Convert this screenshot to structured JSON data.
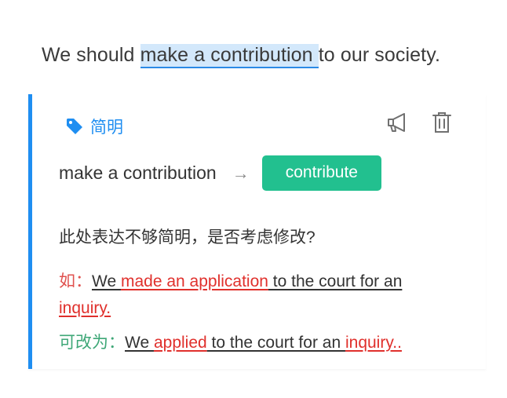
{
  "sentence": {
    "before": "We should ",
    "highlight": "make a contribution ",
    "after": "to our society."
  },
  "card": {
    "tag_label": "简明",
    "tag_icon": "tag-icon",
    "actions": [
      "megaphone-icon",
      "trash-icon"
    ],
    "original": "make a contribution",
    "arrow": "→",
    "suggestion": "contribute",
    "question": "此处表达不够简明，是否考虑修改?",
    "example": {
      "label": "如：",
      "parts": [
        "We ",
        "made an application",
        " to the court for an ",
        "inquiry."
      ]
    },
    "corrected": {
      "label": "可改为：",
      "parts": [
        "We ",
        "applied",
        " to the court for an ",
        "inquiry.."
      ]
    }
  },
  "colors": {
    "accent": "#1f8ef1",
    "suggestion_bg": "#22c08f",
    "example_label": "#e0524f",
    "corrected_label": "#3ea777",
    "error_text": "#e0302c"
  }
}
